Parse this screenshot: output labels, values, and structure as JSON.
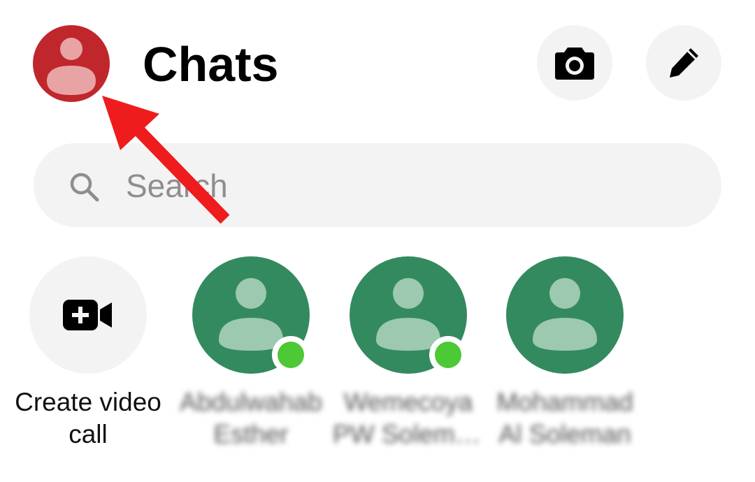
{
  "header": {
    "title": "Chats",
    "profile_icon": "person-icon",
    "camera_icon": "camera-icon",
    "compose_icon": "pencil-icon"
  },
  "search": {
    "placeholder": "Search",
    "icon": "search-icon"
  },
  "stories": {
    "create_video_call": {
      "label_line1": "Create video",
      "label_line2": "call",
      "icon": "video-call-add-icon"
    },
    "contacts": [
      {
        "name_line1": "Abdulwahab",
        "name_line2": "Esther",
        "online": true
      },
      {
        "name_line1": "Wemecoya",
        "name_line2": "PW Soleman...",
        "online": true
      },
      {
        "name_line1": "Mohammad",
        "name_line2": "Al Soleman",
        "online": false
      }
    ]
  },
  "colors": {
    "profile_avatar": "#c0272d",
    "contact_avatar": "#348a5f",
    "online": "#4cc934",
    "annotation_arrow": "#ee1c1c",
    "button_bg": "#f3f3f3"
  }
}
